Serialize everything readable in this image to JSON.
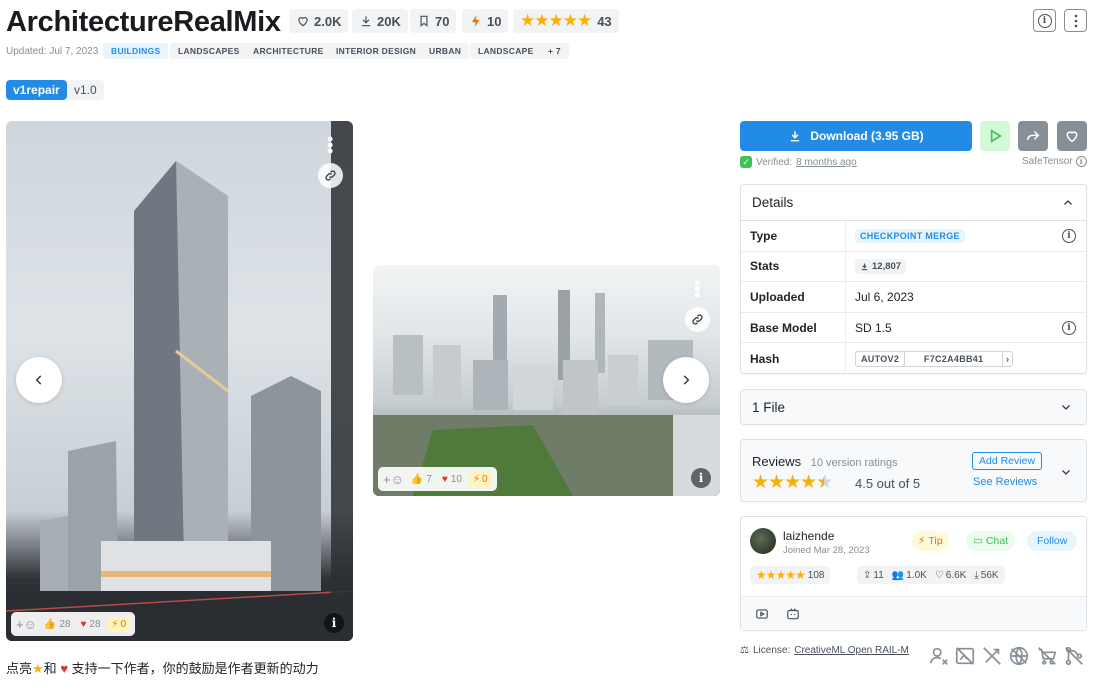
{
  "model": {
    "title": "ArchitectureRealMix",
    "stats": {
      "likes": "2.0K",
      "downloads": "20K",
      "bookmarks": "70",
      "tips": "10",
      "rating_count": "43"
    },
    "updated": "Updated: Jul 7, 2023",
    "tags": [
      "BUILDINGS",
      "LANDSCAPES",
      "ARCHITECTURE",
      "INTERIOR DESIGN",
      "URBAN",
      "LANDSCAPE",
      "+ 7"
    ],
    "versions": [
      "v1repair",
      "v1.0"
    ]
  },
  "gallery": {
    "image1": {
      "reactions": {
        "like": "28",
        "heart": "28",
        "bolt": "0"
      }
    },
    "image2": {
      "reactions": {
        "like": "7",
        "heart": "10",
        "bolt": "0"
      }
    },
    "caption_pre": "点亮",
    "caption_mid": "和",
    "caption_post": "支持一下作者，你的鼓励是作者更新的动力"
  },
  "download": {
    "label": "Download (3.95 GB)",
    "verified_prefix": "Verified:",
    "verified_when": "8 months ago",
    "format": "SafeTensor"
  },
  "details": {
    "heading": "Details",
    "type_label": "Type",
    "type_value": "CHECKPOINT MERGE",
    "stats_label": "Stats",
    "stats_value": "12,807",
    "uploaded_label": "Uploaded",
    "uploaded_value": "Jul 6, 2023",
    "base_label": "Base Model",
    "base_value": "SD 1.5",
    "hash_label": "Hash",
    "hash_type": "AUTOV2",
    "hash_value": "F7C2A4BB41"
  },
  "files": {
    "label": "1 File"
  },
  "reviews": {
    "heading": "Reviews",
    "sub": "10 version ratings",
    "score": "4.5 out of 5",
    "add": "Add Review",
    "see": "See Reviews",
    "rating": 4.5
  },
  "creator": {
    "name": "laizhende",
    "joined": "Joined Mar 28, 2023",
    "tip": "Tip",
    "chat": "Chat",
    "follow": "Follow",
    "rating_count": "108",
    "uploads": "11",
    "followers": "1.0K",
    "likes": "6.6K",
    "downloads": "56K"
  },
  "license": {
    "prefix": "License:",
    "name": "CreativeML Open RAIL-M"
  },
  "colors": {
    "accent": "#228be6",
    "star": "#fab005",
    "heart": "#e03131",
    "bolt": "#e67700",
    "success": "#40c057"
  }
}
